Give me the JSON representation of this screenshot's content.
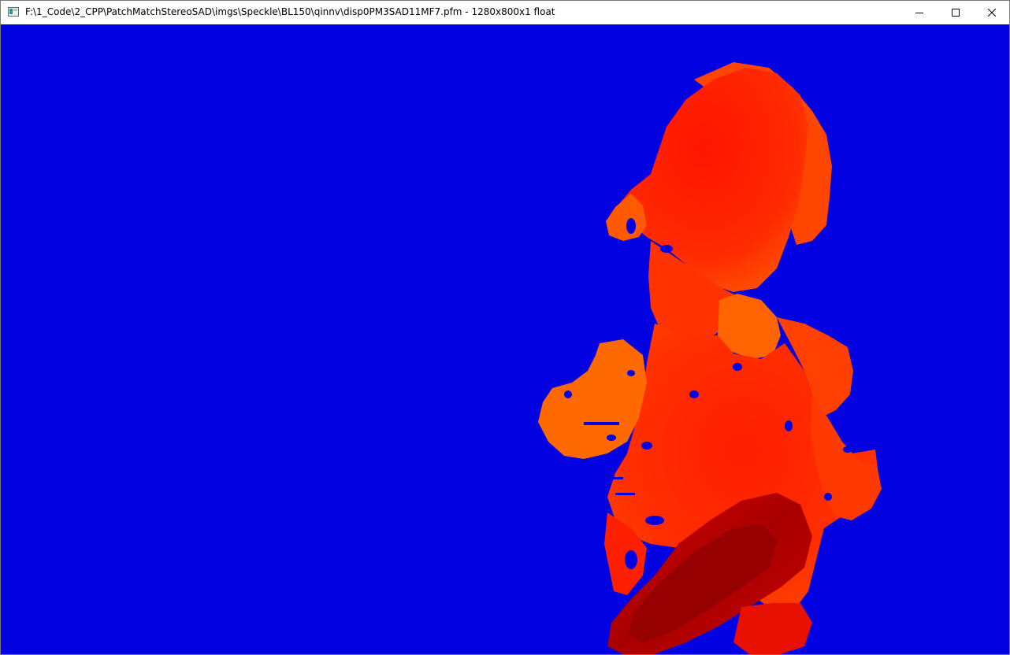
{
  "window": {
    "title": "F:\\1_Code\\2_CPP\\PatchMatchStereoSAD\\imgs\\Speckle\\BL150\\qinnv\\disp0PM3SAD11MF7.pfm - 1280x800x1 float",
    "controls": {
      "minimize_icon": "minimize-icon",
      "maximize_icon": "maximize-icon",
      "close_icon": "close-icon"
    }
  },
  "image": {
    "colormap": "jet",
    "background_color": "#0000e1",
    "accent_colors": [
      "#ff1a00",
      "#ff4a00",
      "#ff7a00",
      "#c80000",
      "#9a0000"
    ]
  }
}
